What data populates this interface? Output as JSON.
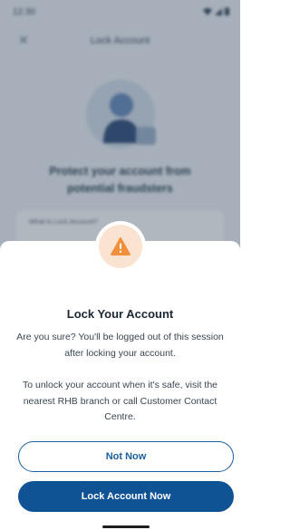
{
  "status_bar": {
    "time": "12:30"
  },
  "background": {
    "title": "Lock Account",
    "headline": "Protect your account from potential fraudsters",
    "info_card_text": "What is Lock Account?"
  },
  "sheet": {
    "title": "Lock Your Account",
    "confirm_text": "Are you sure? You'll be logged out of this session after locking your account.",
    "unlock_text": "To unlock your account when it's safe, visit the nearest RHB branch or call Customer Contact Centre.",
    "secondary_button": "Not Now",
    "primary_button": "Lock Account Now",
    "warning_icon": "warning-triangle-icon"
  },
  "colors": {
    "primary": "#0f5395",
    "outline": "#1a5f9f",
    "warning": "#f0903d",
    "warning_bg": "#fbe3d2"
  }
}
